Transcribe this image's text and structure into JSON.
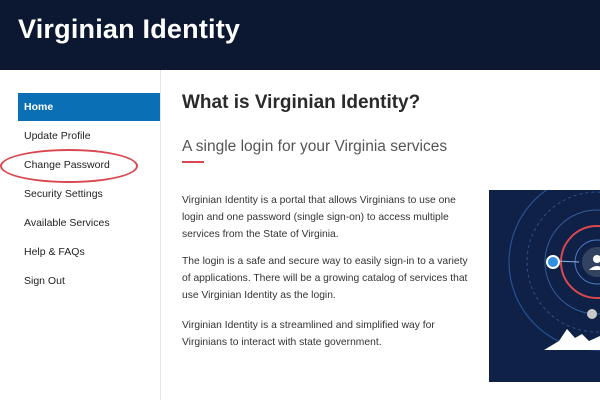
{
  "header": {
    "brand": "Virginian Identity"
  },
  "sidebar": {
    "items": [
      {
        "label": "Home"
      },
      {
        "label": "Update Profile"
      },
      {
        "label": "Change Password"
      },
      {
        "label": "Security Settings"
      },
      {
        "label": "Available Services"
      },
      {
        "label": "Help & FAQs"
      },
      {
        "label": "Sign Out"
      }
    ]
  },
  "main": {
    "title": "What is Virginian Identity?",
    "subtitle": "A single login for your Virginia services",
    "paragraphs": [
      "Virginian Identity is a portal that allows Virginians to use one login and one password (single sign-on) to access multiple services from the State of Virginia.",
      "The login is a safe and secure way to easily sign-in to a variety of applications. There will be a growing catalog of services that use Virginian Identity as the login.",
      "Virginian Identity is a streamlined and simplified way for Virginians to interact with state government."
    ]
  },
  "colors": {
    "header_bg": "#0c1732",
    "nav_active": "#0a6fb5",
    "accent_red": "#d94850",
    "hero_bg": "#0f2146"
  },
  "icons": [
    "user-icon",
    "network-graphic",
    "mountain-graphic"
  ]
}
